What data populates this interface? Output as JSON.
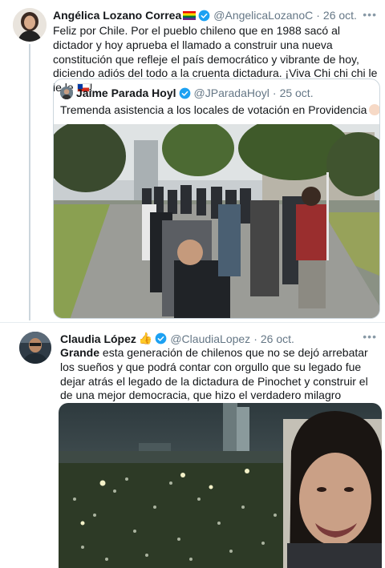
{
  "tweet1": {
    "name": "Angélica Lozano Correa",
    "handle": "@AngelicaLozanoC",
    "date": "26 oct.",
    "text": "Feliz por Chile. Por el pueblo chileno que en 1988 sacó al dictador y hoy aprueba el llamado a construir una nueva constitución que refleje el país democrático y vibrante de hoy, diciendo adiós del todo a la cruenta dictadura. ¡Viva Chi chi chi le le le",
    "text_end": "!",
    "more_icon": "more-dots-icon"
  },
  "quoted": {
    "name": "Jaime Parada Hoyl",
    "handle": "@JParadaHoyl",
    "date": "25 oct.",
    "text": "Tremenda asistencia a los locales de votación en Providencia"
  },
  "tweet2": {
    "name": "Claudia López",
    "handle": "@ClaudiaLopez",
    "date": "26 oct.",
    "text_bold": "Grande",
    "text": " esta generación de chilenos que no se dejó arrebatar los sueños y que podrá contar con orgullo que su legado fue dejar atrás el legado de la dictadura de Pinochet y construir el de una mejor democracia, que hizo el verdadero milagro chileno. Grandes!"
  },
  "separator": "·",
  "more": "•••",
  "colors": {
    "verified": "#1da1f2",
    "text": "#14171a",
    "secondary": "#657786",
    "border": "#ccd6dd"
  }
}
